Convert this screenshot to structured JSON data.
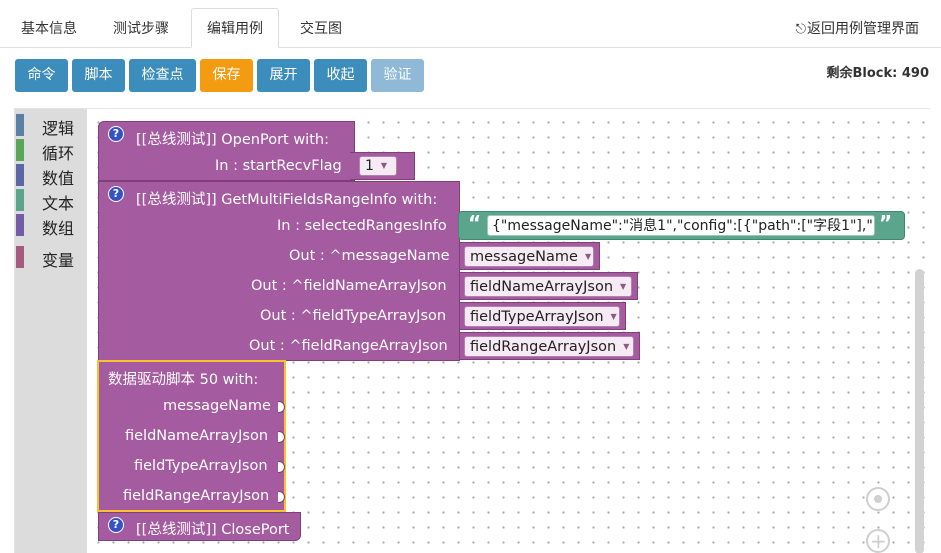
{
  "tabs": [
    "基本信息",
    "测试步骤",
    "编辑用例",
    "交互图"
  ],
  "back_link": "返回用例管理界面",
  "toolbar": {
    "buttons": [
      "命令",
      "脚本",
      "检查点",
      "保存",
      "展开",
      "收起",
      "验证"
    ],
    "remaining_label": "剩余Block: 490"
  },
  "toolbox": {
    "categories": [
      {
        "label": "逻辑",
        "color": "#5b80a5"
      },
      {
        "label": "循环",
        "color": "#5ba55b"
      },
      {
        "label": "数值",
        "color": "#5b67a5"
      },
      {
        "label": "文本",
        "color": "#5ba58c"
      },
      {
        "label": "数组",
        "color": "#745ba5"
      },
      {
        "label": "变量",
        "color": "#a55b80"
      }
    ]
  },
  "blocks": {
    "open_port": {
      "help": "?",
      "title": "[[总线测试]] OpenPort with:",
      "input_label": "In : startRecvFlag",
      "input_value": "1"
    },
    "get_multi": {
      "help": "?",
      "title": "[[总线测试]] GetMultiFieldsRangeInfo with:",
      "input_label": "In : selectedRangesInfo",
      "string_value": "{\"messageName\":\"消息1\",\"config\":[{\"path\":[\"字段1\"],\"...",
      "quote_open": "“",
      "quote_close": "”",
      "outputs": [
        {
          "label": "Out : ^messageName",
          "var": "messageName"
        },
        {
          "label": "Out : ^fieldNameArrayJson",
          "var": "fieldNameArrayJson"
        },
        {
          "label": "Out : ^fieldTypeArrayJson",
          "var": "fieldTypeArrayJson"
        },
        {
          "label": "Out : ^fieldRangeArrayJson",
          "var": "fieldRangeArrayJson"
        }
      ]
    },
    "data_driven": {
      "title": "数据驱动脚本 50 with:",
      "params": [
        "messageName",
        "fieldNameArrayJson",
        "fieldTypeArrayJson",
        "fieldRangeArrayJson"
      ]
    },
    "close_port": {
      "help": "?",
      "title": "[[总线测试]] ClosePort"
    }
  },
  "colors": {
    "procedure": "#a55b9f",
    "text_block": "#5ba58c",
    "primary_button": "#3c8dbc",
    "save_button": "#f39c12",
    "selected_outline": "#fbc02d"
  }
}
